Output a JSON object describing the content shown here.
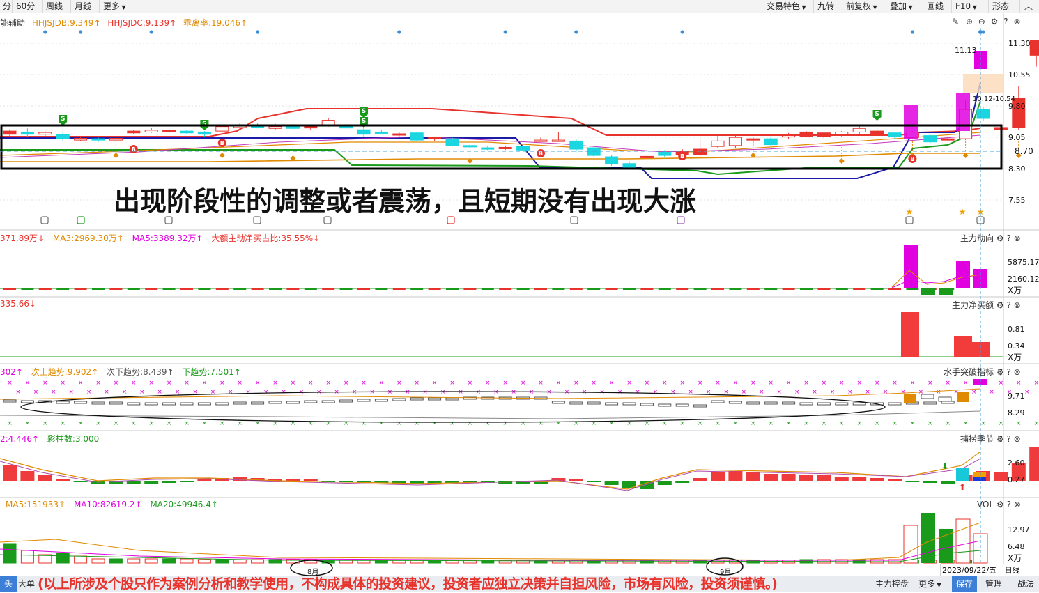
{
  "toolbar": {
    "left": [
      "分",
      "60分",
      "周线",
      "月线",
      "更多"
    ],
    "right": [
      "交易特色",
      "九转",
      "前复权",
      "叠加",
      "画线",
      "F10",
      "形态"
    ]
  },
  "headline": "出现阶段性的调整或者震荡，且短期没有出现大涨",
  "disclaimer": "(以上所涉及个股只作为案例分析和教学使用，不构成具体的投资建议，投资者应独立决策并自担风险，市场有风险，投资须谨慎。)",
  "panels": {
    "main": {
      "legend": [
        {
          "text": "能辅助",
          "color": "#333333"
        },
        {
          "text": "HHJSJDB:9.349↑",
          "color": "#e08a00"
        },
        {
          "text": "HHJSJDC:9.139↑",
          "color": "#e8332c"
        },
        {
          "text": "乖离率:19.046↑",
          "color": "#e08a00"
        }
      ],
      "axis": [
        "11.30",
        "10.55",
        "9.80",
        "9.05",
        "8.70",
        "8.30",
        "7.55"
      ],
      "annotations": {
        "high": "11.13",
        "range": "10.12-10.54"
      }
    },
    "p2": {
      "legend": [
        {
          "text": "371.89万↓",
          "color": "#e8332c"
        },
        {
          "text": "MA3:2969.30万↑",
          "color": "#e08a00"
        },
        {
          "text": "MA5:3389.32万↑",
          "color": "#e000e0"
        },
        {
          "text": "大额主动净买占比:35.55%↓",
          "color": "#e8332c"
        }
      ],
      "title": "主力动向",
      "axis": [
        "5875.17",
        "2160.12",
        "X万"
      ]
    },
    "p3": {
      "legend": [
        {
          "text": "335.66↓",
          "color": "#e8332c"
        }
      ],
      "title": "主力净买额",
      "axis": [
        "0.81",
        "0.34",
        "X万"
      ]
    },
    "p4": {
      "legend": [
        {
          "text": "302↑",
          "color": "#e000e0"
        },
        {
          "text": "次上趋势:9.902↑",
          "color": "#e08a00"
        },
        {
          "text": "次下趋势:8.439↑",
          "color": "#555555"
        },
        {
          "text": "下趋势:7.501↑",
          "color": "#1a9a1a"
        }
      ],
      "title": "水手突破指标",
      "axis": [
        "9.71",
        "8.29"
      ]
    },
    "p5": {
      "legend": [
        {
          "text": "2:4.446↑",
          "color": "#e000e0"
        },
        {
          "text": "彩柱数:3.000",
          "color": "#1a9a1a"
        }
      ],
      "title": "捕捞季节",
      "axis": [
        "2.60",
        "0.27"
      ]
    },
    "p6": {
      "legend": [
        {
          "text": "MA5:151933↑",
          "color": "#e08a00"
        },
        {
          "text": "MA10:82619.2↑",
          "color": "#e000e0"
        },
        {
          "text": "MA20:49946.4↑",
          "color": "#1a9a1a"
        }
      ],
      "title": "VOL",
      "axis": [
        "12.97",
        "6.48",
        "X万"
      ],
      "months": [
        "8月",
        "9月"
      ]
    }
  },
  "date_box": {
    "date": "2023/09/22/五",
    "period": "日线"
  },
  "bottom_bar": {
    "left": [
      "头",
      "大单"
    ],
    "mid": "主力控盘",
    "right": [
      {
        "label": "更多",
        "style": "plain"
      },
      {
        "label": "保存",
        "style": "blue"
      },
      {
        "label": "管理",
        "style": "plain"
      },
      {
        "label": "战法",
        "style": "plain"
      }
    ]
  },
  "chart_data": {
    "type": "candlestick",
    "ylim": [
      7.3,
      11.5
    ],
    "candles": [
      [
        9.05,
        9.12,
        9.16,
        9.0
      ],
      [
        9.1,
        9.05,
        9.18,
        9.0
      ],
      [
        9.05,
        9.09,
        9.12,
        9.0
      ],
      [
        9.05,
        8.95,
        9.1,
        8.9
      ],
      [
        8.92,
        8.96,
        9.0,
        8.9
      ],
      [
        8.95,
        8.92,
        8.98,
        8.88
      ],
      [
        8.92,
        8.96,
        9.0,
        8.9
      ],
      [
        9.08,
        9.12,
        9.15,
        9.05
      ],
      [
        9.1,
        9.14,
        9.2,
        9.08
      ],
      [
        9.1,
        9.14,
        9.2,
        9.08
      ],
      [
        9.12,
        9.08,
        9.15,
        9.05
      ],
      [
        9.1,
        9.05,
        9.12,
        9.0
      ],
      [
        9.12,
        9.22,
        9.25,
        9.1
      ],
      [
        9.2,
        9.26,
        9.3,
        9.15
      ],
      [
        9.25,
        9.2,
        9.3,
        9.18
      ],
      [
        9.18,
        9.22,
        9.28,
        9.15
      ],
      [
        9.24,
        9.18,
        9.3,
        9.15
      ],
      [
        9.2,
        9.22,
        9.25,
        9.15
      ],
      [
        9.26,
        9.36,
        9.4,
        9.22
      ],
      [
        9.22,
        9.2,
        9.28,
        9.16
      ],
      [
        9.15,
        9.05,
        9.2,
        9.0
      ],
      [
        9.1,
        9.08,
        9.15,
        9.05
      ],
      [
        9.05,
        9.06,
        9.1,
        9.0
      ],
      [
        9.08,
        8.92,
        9.1,
        8.9
      ],
      [
        8.95,
        8.98,
        9.0,
        8.9
      ],
      [
        8.95,
        8.8,
        9.0,
        8.78
      ],
      [
        8.8,
        8.78,
        8.85,
        8.75
      ],
      [
        8.75,
        8.72,
        8.8,
        8.7
      ],
      [
        8.75,
        8.76,
        8.8,
        8.7
      ],
      [
        8.78,
        8.7,
        8.8,
        8.68
      ],
      [
        8.9,
        8.92,
        8.98,
        8.88
      ],
      [
        8.9,
        8.92,
        9.1,
        8.88
      ],
      [
        8.9,
        8.72,
        8.95,
        8.65
      ],
      [
        8.75,
        8.58,
        8.78,
        8.55
      ],
      [
        8.55,
        8.4,
        8.6,
        8.35
      ],
      [
        8.4,
        8.32,
        8.45,
        8.3
      ],
      [
        8.55,
        8.56,
        8.6,
        8.5
      ],
      [
        8.65,
        8.58,
        8.7,
        8.55
      ],
      [
        8.6,
        8.68,
        8.72,
        8.5
      ],
      [
        8.6,
        8.72,
        8.95,
        8.55
      ],
      [
        8.78,
        8.9,
        9.02,
        8.75
      ],
      [
        8.8,
        8.98,
        9.05,
        8.75
      ],
      [
        8.95,
        8.95,
        8.98,
        8.8
      ],
      [
        8.95,
        8.82,
        9.0,
        8.8
      ],
      [
        9.0,
        9.02,
        9.08,
        8.95
      ],
      [
        9.0,
        9.1,
        9.12,
        8.98
      ],
      [
        9.0,
        9.08,
        9.1,
        8.95
      ],
      [
        9.05,
        9.1,
        9.12,
        9.0
      ],
      [
        9.1,
        9.18,
        9.25,
        9.05
      ],
      [
        9.05,
        9.12,
        9.2,
        9.0
      ],
      [
        9.08,
        9.0,
        9.1,
        8.95
      ],
      [
        8.98,
        9.1,
        9.12,
        8.95
      ],
      [
        9.02,
        8.88,
        9.05,
        8.85
      ],
      [
        8.95,
        8.95,
        9.0,
        8.9
      ],
      [
        8.95,
        9.6,
        9.8,
        8.92
      ],
      [
        9.6,
        9.4,
        9.65,
        9.35
      ],
      [
        9.15,
        9.2,
        9.3,
        9.1
      ],
      [
        9.2,
        9.85,
        10.12,
        9.15
      ],
      [
        10.8,
        11.13,
        11.13,
        10.55
      ]
    ],
    "stroke_candles": [
      2,
      4,
      6,
      8,
      12,
      13,
      15,
      18,
      21,
      30,
      31,
      33,
      40,
      41,
      44,
      47,
      48,
      51,
      54
    ],
    "volume_ma": {
      "MA5": 151933,
      "MA10": 82619.2,
      "MA20": 49946.4
    },
    "current_price": 8.7
  }
}
